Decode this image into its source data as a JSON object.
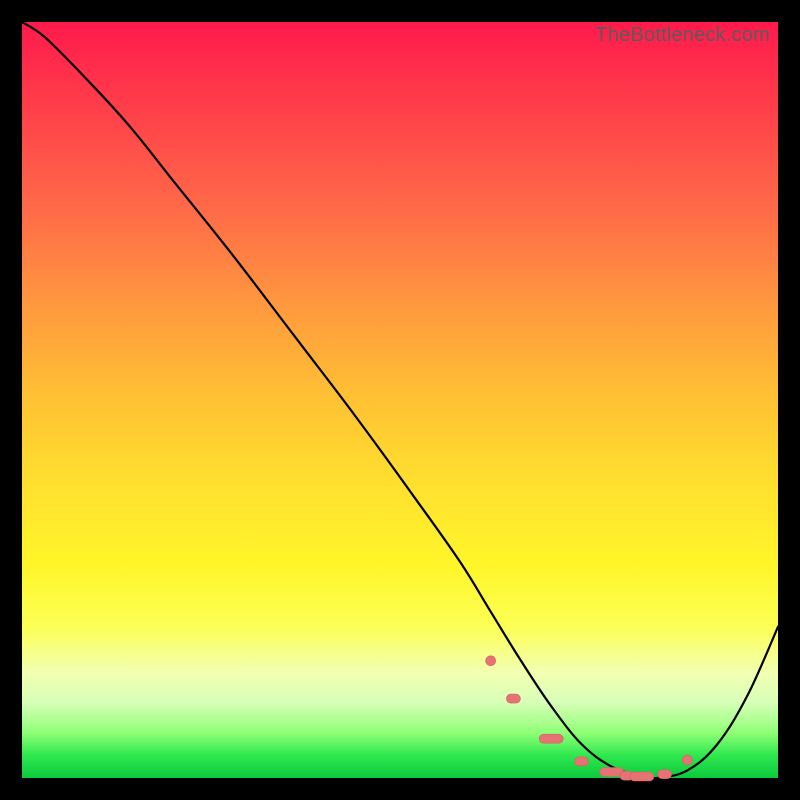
{
  "watermark": "TheBottleneck.com",
  "colors": {
    "frame": "#000000",
    "curve": "#000000",
    "marker_fill": "#e57373",
    "marker_stroke": "#d46060",
    "gradient_top": "#ff1a4c",
    "gradient_bottom": "#0cc93c"
  },
  "chart_data": {
    "type": "line",
    "title": "",
    "xlabel": "",
    "ylabel": "",
    "xlim": [
      0,
      100
    ],
    "ylim": [
      0,
      100
    ],
    "x": [
      0,
      3,
      8,
      14,
      20,
      28,
      36,
      44,
      52,
      58,
      62,
      66,
      70,
      74,
      78,
      82,
      84,
      88,
      92,
      96,
      100
    ],
    "y": [
      100,
      98,
      93,
      86.5,
      79,
      69,
      58.5,
      48,
      37,
      28.5,
      22,
      15.5,
      9.5,
      4.5,
      1.5,
      0.2,
      0,
      1,
      4.5,
      11,
      20
    ],
    "markers_x": [
      62,
      65,
      70,
      74,
      78,
      80,
      82,
      85,
      88
    ],
    "markers_y": [
      15.5,
      10.5,
      5.2,
      2.2,
      0.8,
      0.3,
      0.2,
      0.5,
      2.4
    ],
    "annotations": []
  }
}
